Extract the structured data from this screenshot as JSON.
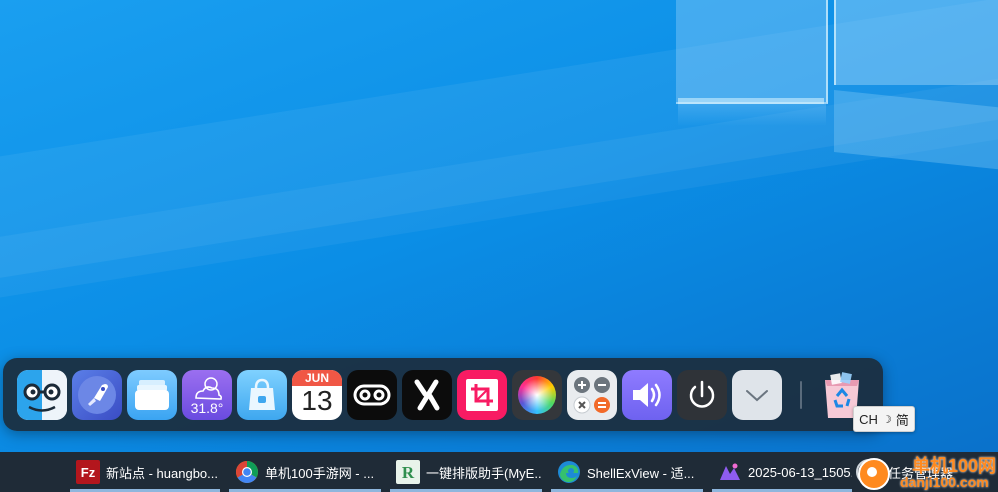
{
  "dock": {
    "apps": [
      {
        "icon": "finder-face-icon"
      },
      {
        "icon": "rocket-launcher-icon"
      },
      {
        "icon": "files-icon"
      },
      {
        "icon": "weather-icon",
        "temperature": "31.8°"
      },
      {
        "icon": "store-bag-icon"
      },
      {
        "icon": "calendar-icon",
        "month": "JUN",
        "day": "13"
      },
      {
        "icon": "reel-icon"
      },
      {
        "icon": "percent-icon"
      },
      {
        "icon": "crop-icon"
      },
      {
        "icon": "color-wheel-icon"
      },
      {
        "icon": "calculator-icon"
      },
      {
        "icon": "volume-icon"
      },
      {
        "icon": "power-icon"
      },
      {
        "icon": "chevron-down-icon"
      },
      {
        "icon": "recycle-bin-icon"
      }
    ]
  },
  "ime": {
    "lang": "CH",
    "mode": "简"
  },
  "taskbar": {
    "items": [
      {
        "label": "新站点 - huangbo...",
        "icon": "filezilla-icon"
      },
      {
        "label": "单机100手游网 - ...",
        "icon": "chrome-icon"
      },
      {
        "label": "一键排版助手(MyE...",
        "icon": "typesetter-icon"
      },
      {
        "label": "ShellExView - 适...",
        "icon": "edge-icon"
      },
      {
        "label": "2025-06-13_1505...",
        "icon": "image-editor-icon"
      }
    ],
    "task_manager_label": "任务管理器"
  },
  "watermark": {
    "line1": "单机100网",
    "line2": "danji100.com"
  }
}
